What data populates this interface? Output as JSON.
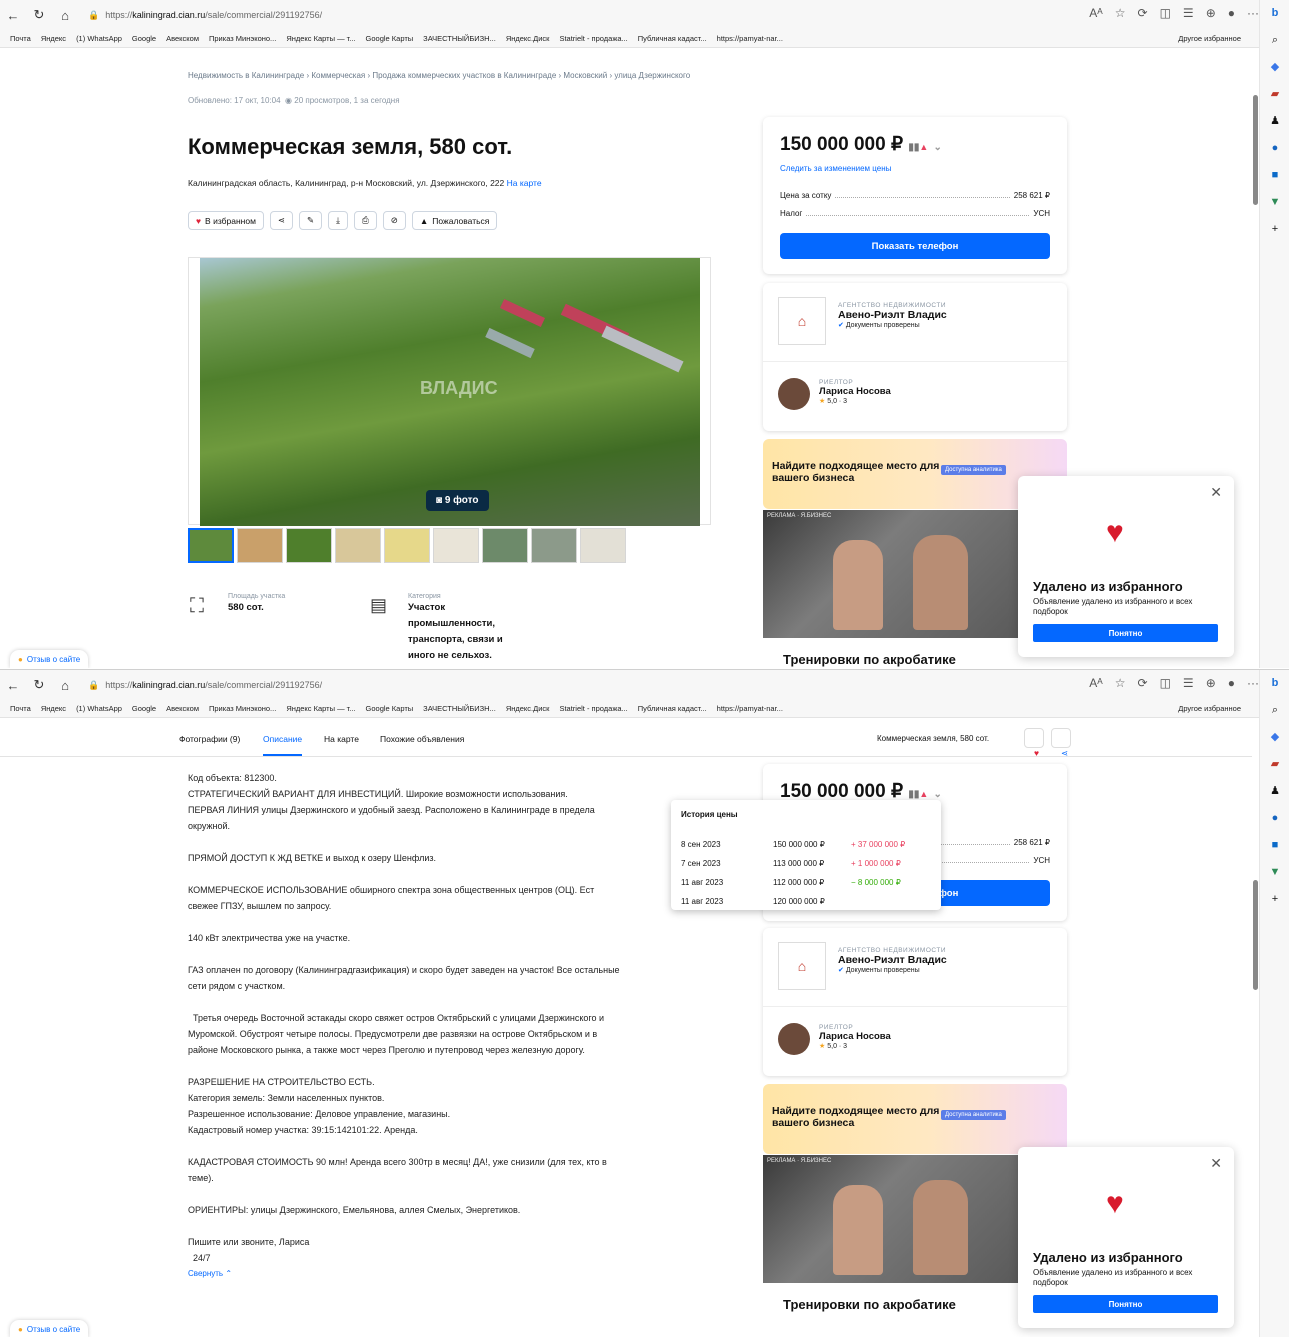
{
  "browser": {
    "url_prefix": "https://",
    "url_host": "kaliningrad.cian.ru",
    "url_path": "/sale/commercial/291192756/",
    "reader": "Aᴬ",
    "bookmarks": [
      "Почта",
      "Яндекс",
      "(1) WhatsApp",
      "Google",
      "Авекском",
      "Приказ Минэконо...",
      "Яндекс Карты — т...",
      "Google Карты",
      "ЗАЧЕСТНЫЙБИЗН...",
      "Яндекс.Диск",
      "Statrielt - продажа...",
      "Публичная кадаст...",
      "https://pamyat-nar..."
    ],
    "other_bookmarks": "Другое избранное"
  },
  "breadcrumbs": "Недвижимость в Калининграде › Коммерческая › Продажа коммерческих участков в Калининграде › Московский › улица Дзержинского",
  "updated": "Обновлено: 17 окт, 10:04",
  "views": "20 просмотров, 1 за сегодня",
  "title": "Коммерческая земля, 580 сот.",
  "address": "Калининградская область, Калининград, р-н Московский, ул. Дзержинского, 222",
  "on_map": "На карте",
  "actions": {
    "favorite": "В избранном",
    "report": "Пожаловаться"
  },
  "gallery": {
    "photos_label": "9 фото",
    "watermark": "ВЛАДИС"
  },
  "specs": {
    "area_label": "Площадь участка",
    "area_value": "580 сот.",
    "category_label": "Категория",
    "category_value": "Участок промышленности, транспорта, связи и иного не сельхоз."
  },
  "price": {
    "value": "150 000 000 ₽",
    "watch": "Следить за изменением цены",
    "per_label": "Цена за сотку",
    "per_value": "258 621 ₽",
    "tax_label": "Налог",
    "tax_value": "УСН",
    "phone_button": "Показать телефон"
  },
  "agency": {
    "label": "АГЕНТСТВО НЕДВИЖИМОСТИ",
    "name": "Авено-Риэлт Владис",
    "verified": "Документы проверены"
  },
  "realtor": {
    "label": "РИЕЛТОР",
    "name": "Лариса Носова",
    "rating": "5,0 · 3"
  },
  "promo": {
    "text": "Найдите подходящее место для вашего бизнеса",
    "tag": "Доступна аналитика"
  },
  "ad": {
    "label": "РЕКЛАМА · Я.БИЗНЕС",
    "title": "Тренировки по акробатике"
  },
  "toast": {
    "title": "Удалено из избранного",
    "text": "Объявление удалено из избранного и всех подборок",
    "button": "Понятно"
  },
  "feedback": "Отзыв о сайте",
  "tabs": {
    "photos": "Фотографии (9)",
    "description": "Описание",
    "map": "На карте",
    "similar": "Похожие объявления",
    "sticky_title": "Коммерческая земля, 580 сот."
  },
  "description": [
    "Код объекта: 812300.",
    "СТРАТЕГИЧЕСКИЙ ВАРИАНТ ДЛЯ ИНВЕСТИЦИЙ. Широкие возможности использования.",
    "ПЕРВАЯ ЛИНИЯ улицы Дзержинского и удобный заезд. Расположено в Калининграде в предела",
    "окружной.",
    "",
    "ПРЯМОЙ ДОСТУП К ЖД ВЕТКЕ и выход к озеру Шенфлиз.",
    "",
    "КОММЕРЧЕСКОЕ ИСПОЛЬЗОВАНИЕ обширного спектра  зона общественных центров (ОЦ). Ест",
    "свежее ГПЗУ, вышлем по запросу.",
    "",
    "140 кВт электричества уже на участке.",
    "",
    "ГАЗ оплачен по договору (Калининградгазификация) и скоро будет заведен на участок!   Все остальные",
    "сети рядом с участком.",
    "",
    "  Третья очередь Восточной эстакады скоро свяжет остров Октябрьский с улицами Дзержинского и",
    "Муромской. Обустроят четыре полосы. Предусмотрели две развязки  на острове Октябрьском и в",
    "районе Московского рынка, а также мост через Преголю и путепровод  через железную дорогу.",
    "",
    "РАЗРЕШЕНИЕ НА СТРОИТЕЛЬСТВО ЕСТЬ.",
    "Категория земель: Земли населенных пунктов.",
    "Разрешенное использование: Деловое управление, магазины.",
    "Кадастровый номер участка: 39:15:142101:22. Аренда.",
    "",
    "КАДАСТРОВАЯ СТОИМОСТЬ 90 млн! Аренда всего 300тр в месяц! ДА!, уже снизили (для тех, кто в",
    "теме).",
    "",
    "ОРИЕНТИРЫ: улицы Дзержинского, Емельянова, аллея Смелых, Энергетиков.",
    "",
    "Пишите или звоните, Лариса",
    "  24/7"
  ],
  "collapse": "Свернуть",
  "history": {
    "title": "История цены",
    "rows": [
      {
        "date": "8 сен 2023",
        "price": "150 000 000 ₽",
        "change": "+ 37 000 000 ₽",
        "dir": "up"
      },
      {
        "date": "7 сен 2023",
        "price": "113 000 000 ₽",
        "change": "+ 1 000 000 ₽",
        "dir": "up"
      },
      {
        "date": "11 авг 2023",
        "price": "112 000 000 ₽",
        "change": "− 8 000 000 ₽",
        "dir": "dn"
      },
      {
        "date": "11 авг 2023",
        "price": "120 000 000 ₽",
        "change": "",
        "dir": ""
      }
    ]
  },
  "colors": {
    "accent": "#0468ff",
    "up": "#e84260",
    "down": "#34ac0a"
  }
}
